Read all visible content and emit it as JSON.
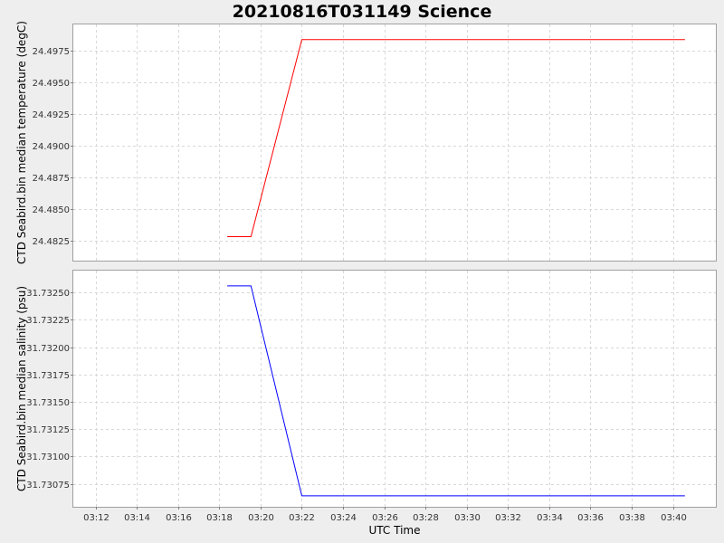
{
  "title": "20210816T031149 Science",
  "chart_data": [
    {
      "type": "line",
      "title": "20210816T031149 Science",
      "xlabel": "UTC Time",
      "ylabel": "CTD Seabird.bin median temperature (degC)",
      "x_ticks": [
        "03:12",
        "03:14",
        "03:16",
        "03:18",
        "03:20",
        "03:22",
        "03:24",
        "03:26",
        "03:28",
        "03:30",
        "03:32",
        "03:34",
        "03:36",
        "03:38",
        "03:40"
      ],
      "y_ticks": [
        "24.4825",
        "24.4850",
        "24.4875",
        "24.4900",
        "24.4925",
        "24.4950",
        "24.4975"
      ],
      "xlim": [
        "03:10:55",
        "03:42:05"
      ],
      "ylim": [
        24.4809,
        24.4996
      ],
      "grid": true,
      "series": [
        {
          "color": "#ff0000",
          "points": [
            {
              "x": "03:18:23",
              "y": 24.4828
            },
            {
              "x": "03:19:32",
              "y": 24.4828
            },
            {
              "x": "03:22:00",
              "y": 24.4984
            },
            {
              "x": "03:40:35",
              "y": 24.4984
            }
          ]
        }
      ]
    },
    {
      "type": "line",
      "xlabel": "UTC Time",
      "ylabel": "CTD Seabird.bin median salinity (psu)",
      "x_ticks": [
        "03:12",
        "03:14",
        "03:16",
        "03:18",
        "03:20",
        "03:22",
        "03:24",
        "03:26",
        "03:28",
        "03:30",
        "03:32",
        "03:34",
        "03:36",
        "03:38",
        "03:40"
      ],
      "y_ticks": [
        "31.73075",
        "31.73100",
        "31.73125",
        "31.73150",
        "31.73175",
        "31.73200",
        "31.73225",
        "31.73250"
      ],
      "xlim": [
        "03:10:55",
        "03:42:05"
      ],
      "ylim": [
        31.73054,
        31.7327
      ],
      "grid": true,
      "series": [
        {
          "color": "#0000ff",
          "points": [
            {
              "x": "03:18:23",
              "y": 31.73256
            },
            {
              "x": "03:19:32",
              "y": 31.73256
            },
            {
              "x": "03:22:00",
              "y": 31.73064
            },
            {
              "x": "03:40:35",
              "y": 31.73064
            }
          ]
        }
      ]
    }
  ]
}
